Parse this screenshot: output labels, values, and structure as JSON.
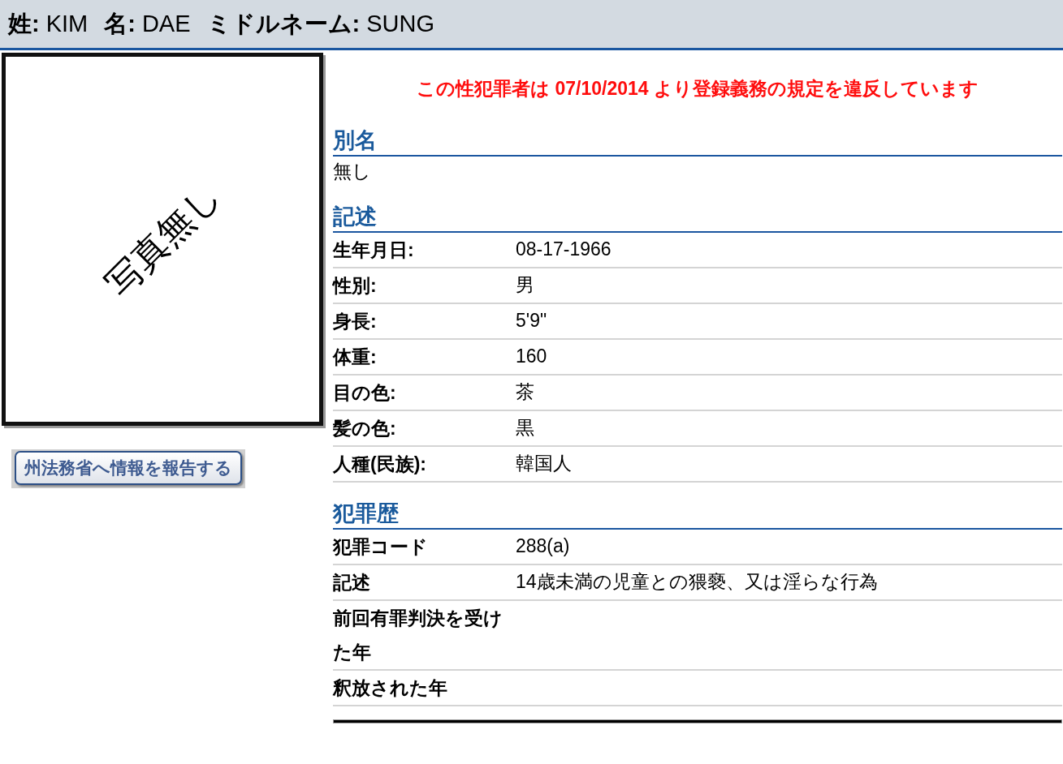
{
  "header": {
    "fields": [
      {
        "label": "姓:",
        "value": "KIM"
      },
      {
        "label": "名:",
        "value": "DAE"
      },
      {
        "label": "ミドルネーム:",
        "value": "SUNG"
      }
    ]
  },
  "photo": {
    "placeholder_text": "写真無し"
  },
  "report_button": "州法務省へ情報を報告する",
  "warning": "この性犯罪者は 07/10/2014 より登録義務の規定を違反しています",
  "sections": [
    {
      "title": "別名",
      "kind": "text",
      "text": "無し"
    },
    {
      "title": "記述",
      "kind": "table",
      "rows": [
        {
          "label": "生年月日:",
          "value": "08-17-1966"
        },
        {
          "label": "性別:",
          "value": "男"
        },
        {
          "label": "身長:",
          "value": "5'9\""
        },
        {
          "label": "体重:",
          "value": "160"
        },
        {
          "label": "目の色:",
          "value": "茶"
        },
        {
          "label": "髪の色:",
          "value": "黒"
        },
        {
          "label": "人種(民族):",
          "value": "韓国人"
        }
      ]
    },
    {
      "title": "犯罪歴",
      "kind": "table",
      "rows": [
        {
          "label": "犯罪コード",
          "value": "288(a)"
        },
        {
          "label": "記述",
          "value": "14歳未満の児童との猥褻、又は淫らな行為"
        },
        {
          "label": "前回有罪判決を受けた年"
        },
        {
          "label": "釈放された年"
        }
      ]
    }
  ]
}
